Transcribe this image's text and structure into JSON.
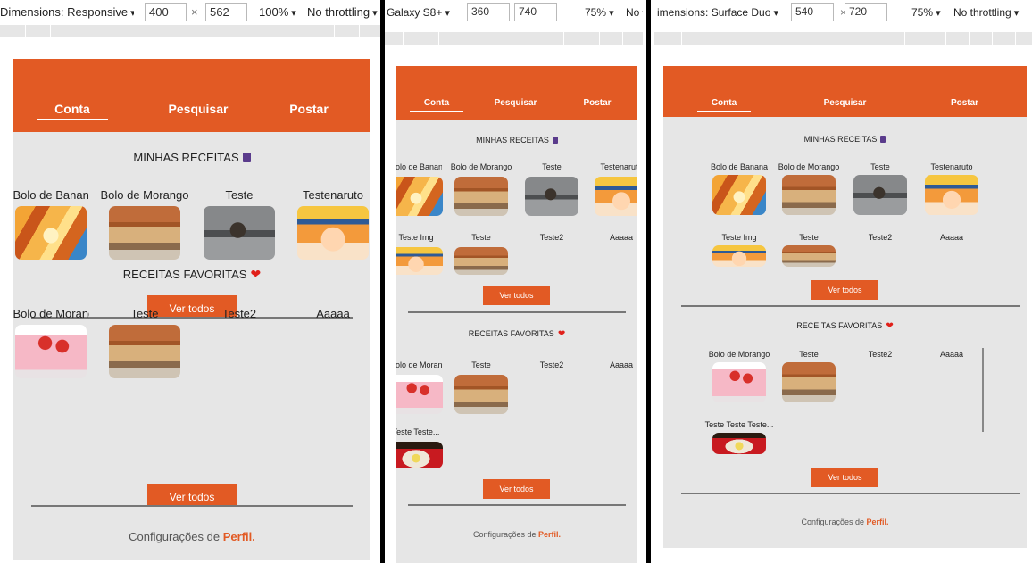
{
  "colors": {
    "accent": "#e25a24",
    "page_bg": "#e6e6e6",
    "heart": "#e0201a"
  },
  "devices": [
    {
      "device": "Dimensions: Responsive",
      "width": "400",
      "height": "562",
      "zoom": "100%",
      "throttle": "No throttling"
    },
    {
      "device": "Galaxy S8+",
      "width": "360",
      "height": "740",
      "zoom": "75%",
      "throttle": "No"
    },
    {
      "device": "imensions: Surface Duo",
      "width": "540",
      "height": "720",
      "zoom": "75%",
      "throttle": "No throttling"
    }
  ],
  "toolbar": {
    "times": "×",
    "throttle_menu_arrow": "▾"
  },
  "app": {
    "nav": [
      "Conta",
      "Pesquisar",
      "Postar"
    ],
    "my_recipes_title": "MINHAS RECEITAS",
    "favorites_title": "RECEITAS FAVORITAS",
    "see_all": "Ver todos",
    "footer_prefix": "Configurações de ",
    "footer_link": "Perfil.",
    "book_icon": "book-icon",
    "heart_icon": "heart-icon",
    "heart_glyph": "❤"
  },
  "panes": [
    {
      "my_recipes": [
        {
          "title": "Bolo de Banana",
          "image": "fox"
        },
        {
          "title": "Bolo de Morango",
          "image": "cake"
        },
        {
          "title": "Teste",
          "image": "man"
        },
        {
          "title": "Testenaruto",
          "image": "naruto"
        }
      ],
      "favorites": [
        {
          "title": "Bolo de Morango",
          "image": "strawberry-cake"
        },
        {
          "title": "Teste",
          "image": "cake"
        },
        {
          "title": "Teste2",
          "image": ""
        },
        {
          "title": "Aaaaa",
          "image": ""
        }
      ]
    },
    {
      "my_recipes": [
        {
          "title": "Bolo de Banana",
          "image": "fox"
        },
        {
          "title": "Bolo de Morango",
          "image": "cake"
        },
        {
          "title": "Teste",
          "image": "man"
        },
        {
          "title": "Testenaruto",
          "image": "naruto"
        },
        {
          "title": "Teste Img",
          "image": "naruto"
        },
        {
          "title": "Teste",
          "image": "cake"
        },
        {
          "title": "Teste2",
          "image": ""
        },
        {
          "title": "Aaaaa",
          "image": ""
        }
      ],
      "favorites": [
        {
          "title": "Bolo de Morango",
          "image": "strawberry-cake"
        },
        {
          "title": "Teste",
          "image": "cake"
        },
        {
          "title": "Teste2",
          "image": ""
        },
        {
          "title": "Aaaaa",
          "image": ""
        },
        {
          "title": "Teste Teste...",
          "image": "ramen"
        }
      ]
    },
    {
      "my_recipes": [
        {
          "title": "Bolo de Banana",
          "image": "fox"
        },
        {
          "title": "Bolo de Morango",
          "image": "cake"
        },
        {
          "title": "Teste",
          "image": "man"
        },
        {
          "title": "Testenaruto",
          "image": "naruto"
        },
        {
          "title": "Teste Img",
          "image": "naruto"
        },
        {
          "title": "Teste",
          "image": "cake"
        },
        {
          "title": "Teste2",
          "image": ""
        },
        {
          "title": "Aaaaa",
          "image": ""
        }
      ],
      "favorites": [
        {
          "title": "Bolo de Morango",
          "image": "strawberry-cake"
        },
        {
          "title": "Teste",
          "image": "cake"
        },
        {
          "title": "Teste2",
          "image": ""
        },
        {
          "title": "Aaaaa",
          "image": ""
        },
        {
          "title": "Teste Teste Teste...",
          "image": "ramen"
        }
      ]
    }
  ]
}
